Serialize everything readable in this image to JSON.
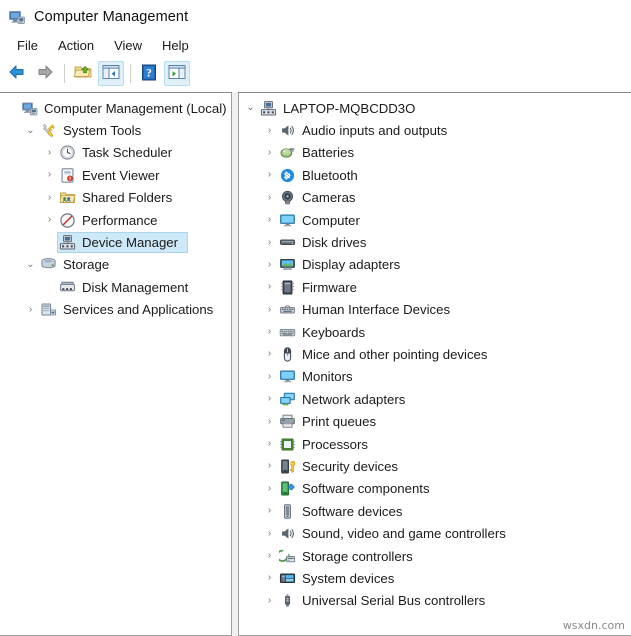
{
  "window": {
    "title": "Computer Management",
    "icon": "computer-management-icon"
  },
  "menubar": {
    "items": [
      {
        "label": "File",
        "name": "menu-file"
      },
      {
        "label": "Action",
        "name": "menu-action"
      },
      {
        "label": "View",
        "name": "menu-view"
      },
      {
        "label": "Help",
        "name": "menu-help"
      }
    ]
  },
  "toolbar": {
    "buttons": [
      {
        "name": "back-button",
        "icon": "back-arrow-icon",
        "framed": false
      },
      {
        "name": "forward-button",
        "icon": "forward-arrow-icon",
        "framed": false
      },
      {
        "name": "up-one-level-button",
        "icon": "folder-up-icon",
        "framed": false
      },
      {
        "name": "show-hide-console-tree-button",
        "icon": "console-tree-icon",
        "framed": true
      },
      {
        "name": "help-button",
        "icon": "help-question-icon",
        "framed": false
      },
      {
        "name": "show-action-pane-button",
        "icon": "action-pane-icon",
        "framed": true
      }
    ]
  },
  "left_pane": {
    "name": "console-tree-pane",
    "nodes": [
      {
        "label": "Computer Management (Local)",
        "indent": 0,
        "state": "none",
        "icon": "computer-management-icon",
        "selected": false
      },
      {
        "label": "System Tools",
        "indent": 1,
        "state": "expanded",
        "icon": "system-tools-icon",
        "selected": false
      },
      {
        "label": "Task Scheduler",
        "indent": 2,
        "state": "collapsed",
        "icon": "task-scheduler-icon",
        "selected": false
      },
      {
        "label": "Event Viewer",
        "indent": 2,
        "state": "collapsed",
        "icon": "event-viewer-icon",
        "selected": false
      },
      {
        "label": "Shared Folders",
        "indent": 2,
        "state": "collapsed",
        "icon": "shared-folders-icon",
        "selected": false
      },
      {
        "label": "Performance",
        "indent": 2,
        "state": "collapsed",
        "icon": "performance-icon",
        "selected": false
      },
      {
        "label": "Device Manager",
        "indent": 2,
        "state": "none",
        "icon": "device-manager-icon",
        "selected": true
      },
      {
        "label": "Storage",
        "indent": 1,
        "state": "expanded",
        "icon": "storage-icon",
        "selected": false
      },
      {
        "label": "Disk Management",
        "indent": 2,
        "state": "none",
        "icon": "disk-management-icon",
        "selected": false
      },
      {
        "label": "Services and Applications",
        "indent": 1,
        "state": "collapsed",
        "icon": "services-apps-icon",
        "selected": false
      }
    ]
  },
  "right_pane": {
    "name": "device-manager-pane",
    "root": {
      "label": "LAPTOP-MQBCDD3O",
      "state": "expanded",
      "icon": "computer-node-icon"
    },
    "devices": [
      {
        "label": "Audio inputs and outputs",
        "icon": "speaker-icon"
      },
      {
        "label": "Batteries",
        "icon": "battery-icon"
      },
      {
        "label": "Bluetooth",
        "icon": "bluetooth-icon"
      },
      {
        "label": "Cameras",
        "icon": "camera-icon"
      },
      {
        "label": "Computer",
        "icon": "monitor-icon"
      },
      {
        "label": "Disk drives",
        "icon": "disk-drive-icon"
      },
      {
        "label": "Display adapters",
        "icon": "display-adapter-icon"
      },
      {
        "label": "Firmware",
        "icon": "firmware-chip-icon"
      },
      {
        "label": "Human Interface Devices",
        "icon": "hid-icon"
      },
      {
        "label": "Keyboards",
        "icon": "keyboard-icon"
      },
      {
        "label": "Mice and other pointing devices",
        "icon": "mouse-icon"
      },
      {
        "label": "Monitors",
        "icon": "monitor-icon"
      },
      {
        "label": "Network adapters",
        "icon": "network-adapter-icon"
      },
      {
        "label": "Print queues",
        "icon": "printer-icon"
      },
      {
        "label": "Processors",
        "icon": "processor-icon"
      },
      {
        "label": "Security devices",
        "icon": "security-device-icon"
      },
      {
        "label": "Software components",
        "icon": "software-component-icon"
      },
      {
        "label": "Software devices",
        "icon": "software-device-icon"
      },
      {
        "label": "Sound, video and game controllers",
        "icon": "sound-controller-icon"
      },
      {
        "label": "Storage controllers",
        "icon": "storage-controller-icon"
      },
      {
        "label": "System devices",
        "icon": "system-device-icon"
      },
      {
        "label": "Universal Serial Bus controllers",
        "icon": "usb-icon"
      }
    ]
  },
  "watermark": {
    "text": "wsxdn.com"
  },
  "glyphs": {
    "chevron_collapsed": "›",
    "chevron_expanded": "⌄"
  },
  "colors": {
    "selection_fill": "#cde8f6",
    "selection_border": "#a9d4ea",
    "pane_border": "#9e9e9e",
    "text": "#1b1b1b"
  }
}
